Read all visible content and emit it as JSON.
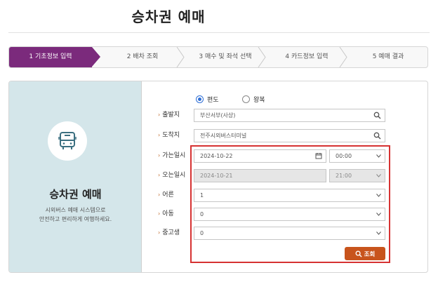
{
  "header": {
    "title": "승차권 예매"
  },
  "steps": [
    {
      "label": "1 기초정보 입력",
      "active": true
    },
    {
      "label": "2 배차 조회",
      "active": false
    },
    {
      "label": "3 매수 및 좌석 선택",
      "active": false
    },
    {
      "label": "4 카드정보 입력",
      "active": false
    },
    {
      "label": "5 예매 결과",
      "active": false
    }
  ],
  "left_panel": {
    "icon": "bus-icon",
    "title": "승차권 예매",
    "desc_line1": "시외버스 예매 시스템으로",
    "desc_line2": "안전하고 편리하게 여행하세요."
  },
  "trip_type": {
    "options": [
      "편도",
      "왕복"
    ],
    "selected": "편도"
  },
  "form": {
    "departure": {
      "label": "출발지",
      "value": "부산서부(사상)"
    },
    "arrival": {
      "label": "도착지",
      "value": "전주시외버스터미널"
    },
    "go_date": {
      "label": "가는일시",
      "date": "2024-10-22",
      "time": "00:00"
    },
    "return_date": {
      "label": "오는일시",
      "date": "2024-10-21",
      "time": "21:00"
    },
    "adult": {
      "label": "어른",
      "value": "1"
    },
    "child": {
      "label": "아동",
      "value": "0"
    },
    "youth": {
      "label": "중고생",
      "value": "0"
    }
  },
  "search_button": {
    "label": "조회",
    "icon": "search-icon"
  },
  "colors": {
    "step_active": "#7b2a7c",
    "left_panel_bg": "#d4e6ea",
    "highlight": "#d63232",
    "button": "#c8541c",
    "label_chevron": "#c06a2a"
  }
}
